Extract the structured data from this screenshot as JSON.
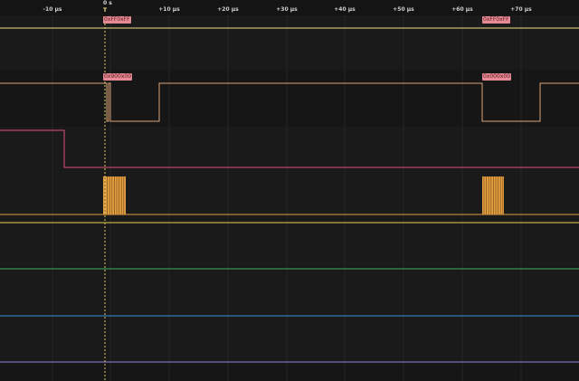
{
  "ruler": {
    "trigger_label": "0 s",
    "trigger_marker": "T",
    "ticks": [
      "-10 μs",
      "+10 μs",
      "+20 μs",
      "+30 μs",
      "+40 μs",
      "+50 μs",
      "+60 μs",
      "+70 μs"
    ]
  },
  "decoded": {
    "row1": [
      "0xFF0xFF",
      "0xFF0xFF"
    ],
    "row2": [
      "0x900x00",
      "0x000x00"
    ]
  },
  "colors": {
    "channel0": "#f2e08a",
    "channel1": "#d9a57a",
    "channel2": "#e0507a",
    "channel3": "#e3a040",
    "channel4": "#e8d44a",
    "channel5": "#3fae5e",
    "channel6": "#3f8fd8",
    "channel7": "#8f7fe0",
    "trigger": "#d8c860",
    "grid": "#262626",
    "decode_label_bg": "#e58a95"
  }
}
